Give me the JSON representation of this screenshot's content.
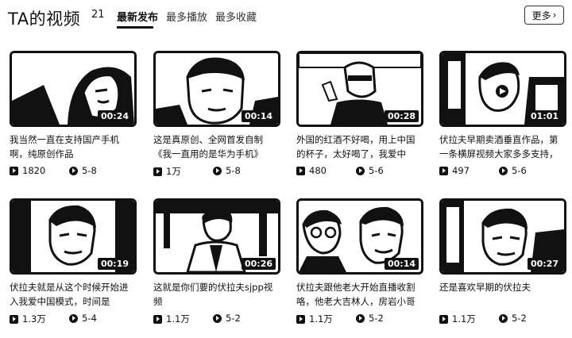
{
  "header": {
    "title": "TA的视频",
    "count": "21",
    "tabs": [
      {
        "label": "最新发布",
        "active": true
      },
      {
        "label": "最多播放",
        "active": false
      },
      {
        "label": "最多收藏",
        "active": false
      }
    ],
    "more_label": "更多"
  },
  "videos": [
    {
      "duration": "00:24",
      "title": "我当然一直在支持国产手机啊，纯原创作品",
      "plays": "1820",
      "shares": "5-8"
    },
    {
      "duration": "00:14",
      "title": "这是真原创、全网首发自制《我一直用的是华为手机》",
      "plays": "1万",
      "shares": "5-8"
    },
    {
      "duration": "00:28",
      "title": "外国的红酒不好喝，用上中国的杯子，太好喝了，我爱中",
      "plays": "480",
      "shares": "5-6"
    },
    {
      "duration": "01:01",
      "title": "伏拉夫早期卖酒垂直作品，第一条横屏视频大家多多支持，",
      "plays": "497",
      "shares": "5-6"
    },
    {
      "duration": "00:19",
      "title": "伏拉夫就是从这个时候开始进入我爱中国模式，时间是",
      "plays": "1.3万",
      "shares": "5-4"
    },
    {
      "duration": "00:26",
      "title": "这就是你们要的伏拉夫sjpp视频",
      "plays": "1.1万",
      "shares": "5-2"
    },
    {
      "duration": "00:14",
      "title": "伏拉夫跟他老大开始直播收割咯，他老大吉林人，房岩小哥",
      "plays": "1.1万",
      "shares": "5-2"
    },
    {
      "duration": "00:27",
      "title": "还是喜欢早期的伏拉夫",
      "plays": "1.1万",
      "shares": "5-2"
    }
  ],
  "icons": {
    "play": "play-count-icon",
    "share": "share-icon",
    "more": "chevron-right-icon"
  }
}
